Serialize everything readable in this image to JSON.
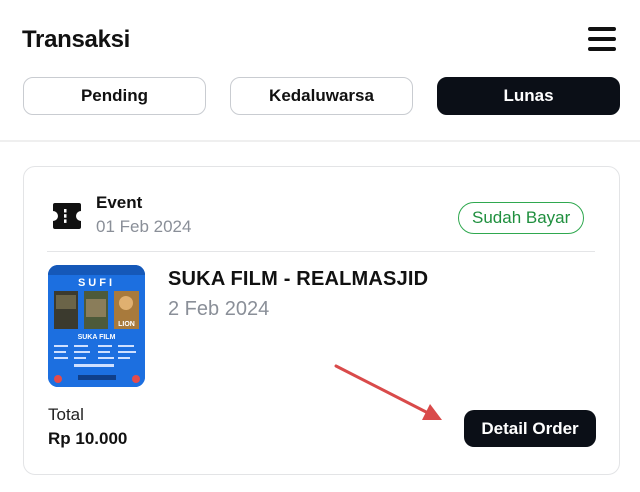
{
  "header": {
    "title": "Transaksi",
    "menu_icon": "hamburger-menu-icon"
  },
  "tabs": [
    {
      "label": "Pending",
      "active": false
    },
    {
      "label": "Kedaluwarsa",
      "active": false
    },
    {
      "label": "Lunas",
      "active": true
    }
  ],
  "transaction": {
    "category_icon": "ticket-icon",
    "category": "Event",
    "order_date": "01 Feb 2024",
    "status": "Sudah Bayar",
    "status_color": "#2fa84f",
    "item": {
      "title": "SUKA FILM - REALMASJID",
      "event_date": "2 Feb 2024",
      "poster": {
        "header_text": "SUFI",
        "subtitle_text": "SUKA FILM",
        "film_caption": "LION",
        "background_color": "#1c6fe0"
      }
    },
    "total_label": "Total",
    "total_amount": "Rp 10.000",
    "detail_button": "Detail Order"
  },
  "annotation": {
    "arrow_color": "#d94a4a",
    "arrow_target": "detail-order-button"
  }
}
